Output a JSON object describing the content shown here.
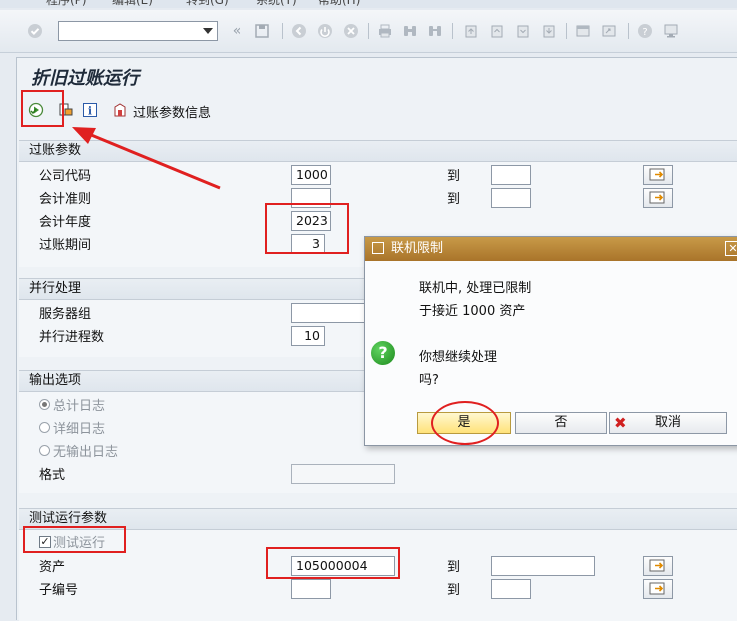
{
  "menubar": {
    "items": [
      "程序(P)",
      "编辑(E)",
      "转到(G)",
      "系统(Y)",
      "帮助(H)"
    ]
  },
  "command_field": {
    "value": ""
  },
  "title": "折旧过账运行",
  "app_toolbar": {
    "param_info_label": "过账参数信息"
  },
  "groups": {
    "posting": {
      "title": "过账参数",
      "to_label": "到",
      "company_code": {
        "label": "公司代码",
        "value": "1000"
      },
      "accounting_principle": {
        "label": "会计准则",
        "value": ""
      },
      "fiscal_year": {
        "label": "会计年度",
        "value": "2023"
      },
      "posting_period": {
        "label": "过账期间",
        "value": "3"
      }
    },
    "parallel": {
      "title": "并行处理",
      "server_group": {
        "label": "服务器组",
        "value": ""
      },
      "parallel_jobs": {
        "label": "并行进程数",
        "value": "10"
      }
    },
    "output": {
      "title": "输出选项",
      "radio_total": "总计日志",
      "radio_detail": "详细日志",
      "radio_none": "无输出日志",
      "format": {
        "label": "格式",
        "value": ""
      }
    },
    "test": {
      "title": "测试运行参数",
      "test_run_label": "测试运行",
      "asset": {
        "label": "资产",
        "value": "105000004"
      },
      "sub_number": {
        "label": "子编号",
        "value": ""
      },
      "to_label": "到"
    }
  },
  "dialog": {
    "title": "联机限制",
    "line1": "联机中, 处理已限制",
    "line2": "于接近 1000  资产",
    "question_line1": "你想继续处理",
    "question_line2": "吗?",
    "yes_label": "是",
    "no_label": "否",
    "cancel_label": "取消"
  },
  "colors": {
    "dialog_titlebar": "#b8843a",
    "annotation_red": "#e02020",
    "yes_button": "#ffe27a"
  }
}
